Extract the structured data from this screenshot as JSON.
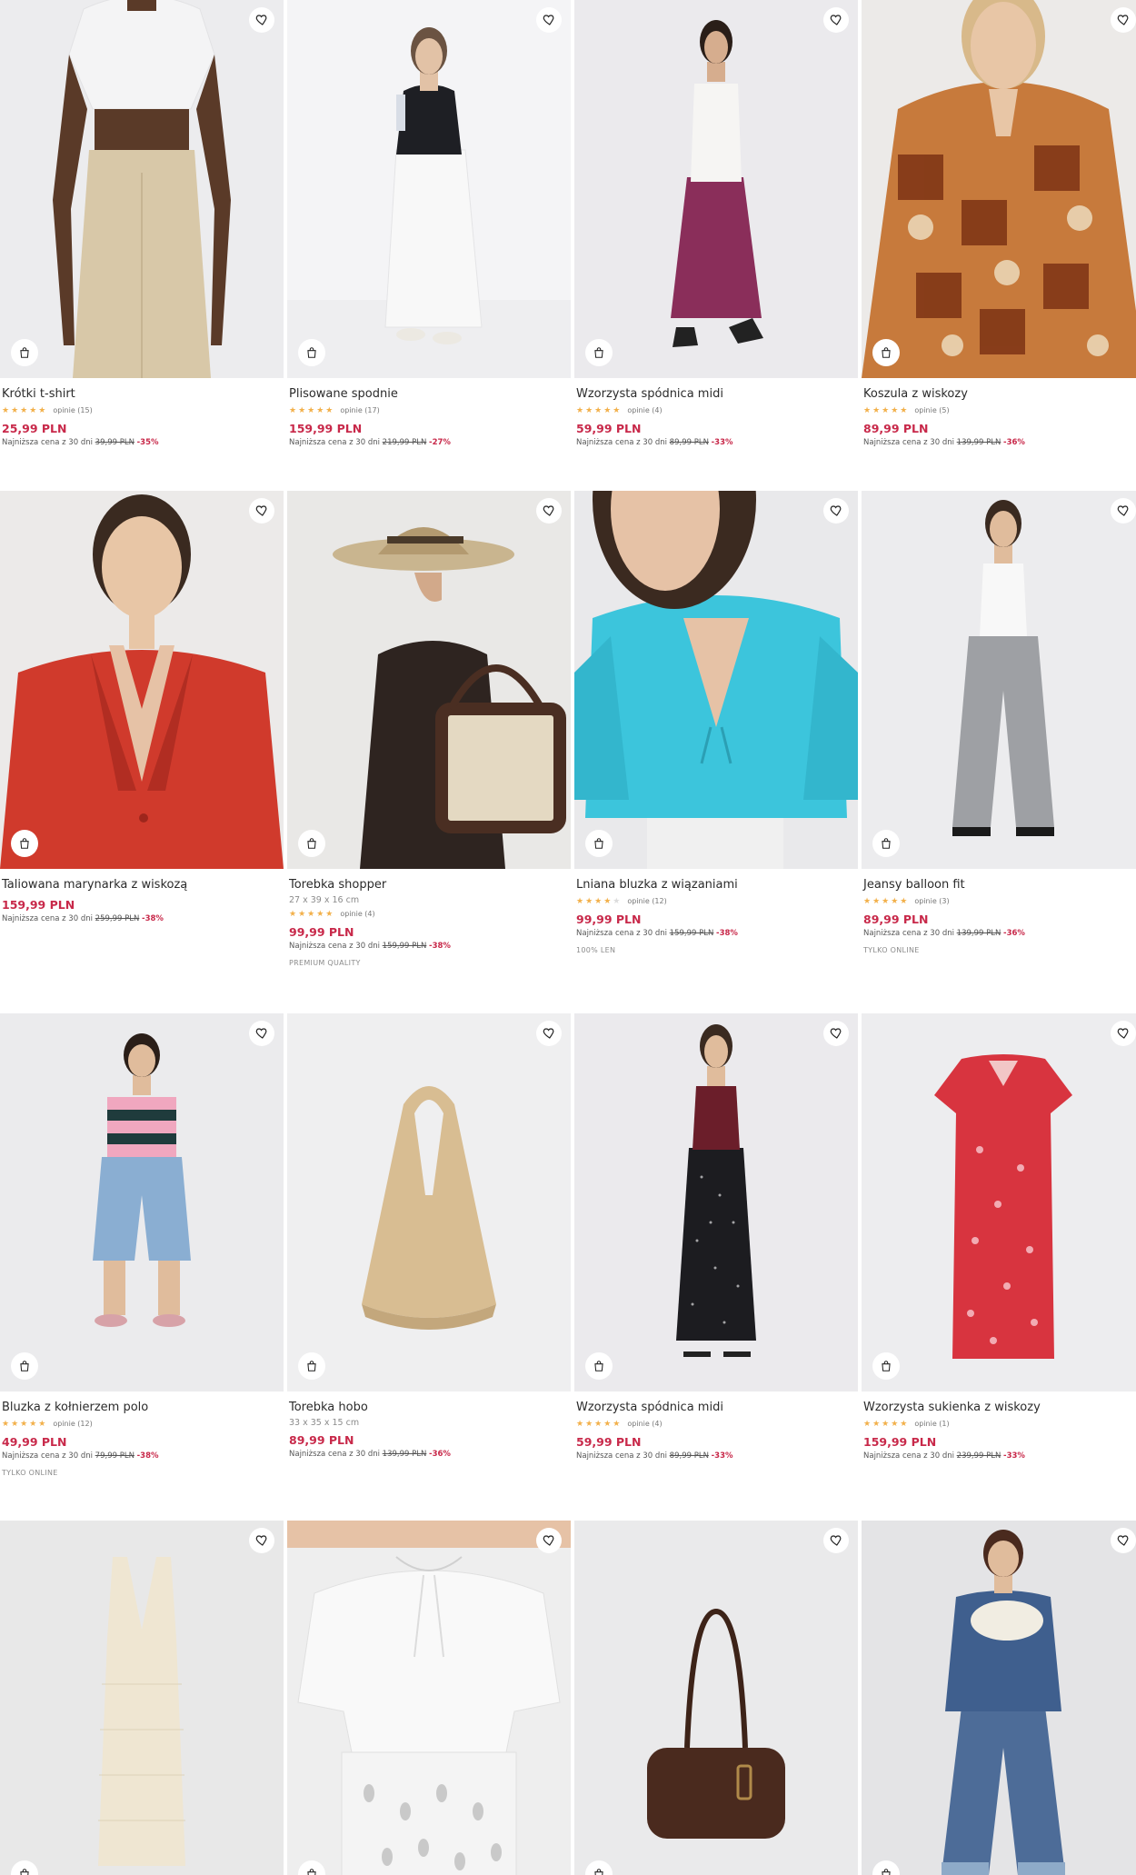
{
  "products": [
    {
      "name": "Krótki t-shirt",
      "dims": "",
      "stars": 4.5,
      "reviews": "opinie (15)",
      "price": "25,99 PLN",
      "lowest_label": "Najniższa cena z 30 dni",
      "old_price": "39,99 PLN",
      "discount": "-35%",
      "tag": "",
      "bg": "#ececee",
      "photo": "model-white-crop-top-beige-trousers"
    },
    {
      "name": "Plisowane spodnie",
      "dims": "",
      "stars": 4.5,
      "reviews": "opinie (17)",
      "price": "159,99 PLN",
      "lowest_label": "Najniższa cena z 30 dni",
      "old_price": "219,99 PLN",
      "discount": "-27%",
      "tag": "",
      "bg": "#eeeef0",
      "photo": "model-black-polo-white-pleated-trousers"
    },
    {
      "name": "Wzorzysta spódnica midi",
      "dims": "",
      "stars": 5,
      "reviews": "opinie (4)",
      "price": "59,99 PLN",
      "lowest_label": "Najniższa cena z 30 dni",
      "old_price": "89,99 PLN",
      "discount": "-33%",
      "tag": "",
      "bg": "#ebeaed",
      "photo": "model-white-top-burgundy-midi-skirt"
    },
    {
      "name": "Koszula z wiskozy",
      "dims": "",
      "stars": 4.5,
      "reviews": "opinie (5)",
      "price": "89,99 PLN",
      "lowest_label": "Najniższa cena z 30 dni",
      "old_price": "139,99 PLN",
      "discount": "-36%",
      "tag": "",
      "bg": "#eceae8",
      "photo": "model-patterned-viscose-shirt"
    },
    {
      "name": "Taliowana marynarka z wiskozą",
      "dims": "",
      "stars": 0,
      "reviews": "",
      "price": "159,99 PLN",
      "lowest_label": "Najniższa cena z 30 dni",
      "old_price": "259,99 PLN",
      "discount": "-38%",
      "tag": "",
      "bg": "#eceae9",
      "photo": "model-red-tailored-blazer"
    },
    {
      "name": "Torebka shopper",
      "dims": "27 x 39 x 16 cm",
      "stars": 5,
      "reviews": "opinie (4)",
      "price": "99,99 PLN",
      "lowest_label": "Najniższa cena z 30 dni",
      "old_price": "159,99 PLN",
      "discount": "-38%",
      "tag": "PREMIUM QUALITY",
      "bg": "#e9e8e6",
      "photo": "model-straw-hat-canvas-shopper-bag"
    },
    {
      "name": "Lniana bluzka z wiązaniami",
      "dims": "",
      "stars": 4,
      "reviews": "opinie (12)",
      "price": "99,99 PLN",
      "lowest_label": "Najniższa cena z 30 dni",
      "old_price": "159,99 PLN",
      "discount": "-38%",
      "tag": "100% LEN",
      "bg": "#e9e9eb",
      "photo": "model-turquoise-linen-blouse"
    },
    {
      "name": "Jeansy balloon fit",
      "dims": "",
      "stars": 4.5,
      "reviews": "opinie (3)",
      "price": "89,99 PLN",
      "lowest_label": "Najniższa cena z 30 dni",
      "old_price": "139,99 PLN",
      "discount": "-36%",
      "tag": "TYLKO ONLINE",
      "bg": "#ececee",
      "photo": "model-white-tank-grey-balloon-jeans"
    },
    {
      "name": "Bluzka z kołnierzem polo",
      "dims": "",
      "stars": 4.5,
      "reviews": "opinie (12)",
      "price": "49,99 PLN",
      "lowest_label": "Najniższa cena z 30 dni",
      "old_price": "79,99 PLN",
      "discount": "-38%",
      "tag": "TYLKO ONLINE",
      "bg": "#ebebed",
      "photo": "model-striped-polo-denim-shorts"
    },
    {
      "name": "Torebka hobo",
      "dims": "33 x 35 x 15 cm",
      "stars": 0,
      "reviews": "",
      "price": "89,99 PLN",
      "lowest_label": "Najniższa cena z 30 dni",
      "old_price": "139,99 PLN",
      "discount": "-36%",
      "tag": "",
      "bg": "#efeff0",
      "photo": "beige-hobo-bag"
    },
    {
      "name": "Wzorzysta spódnica midi",
      "dims": "",
      "stars": 5,
      "reviews": "opinie (4)",
      "price": "59,99 PLN",
      "lowest_label": "Najniższa cena z 30 dni",
      "old_price": "89,99 PLN",
      "discount": "-33%",
      "tag": "",
      "bg": "#ebeaed",
      "photo": "model-burgundy-tank-dotted-skirt"
    },
    {
      "name": "Wzorzysta sukienka z wiskozy",
      "dims": "",
      "stars": 5,
      "reviews": "opinie (1)",
      "price": "159,99 PLN",
      "lowest_label": "Najniższa cena z 30 dni",
      "old_price": "239,99 PLN",
      "discount": "-33%",
      "tag": "",
      "bg": "#ededef",
      "photo": "red-floral-viscose-dress"
    },
    {
      "name": "",
      "dims": "",
      "stars": 0,
      "reviews": "",
      "price": "",
      "lowest_label": "",
      "old_price": "",
      "discount": "",
      "tag": "",
      "bg": "#e8e8e8",
      "photo": "cream-crochet-dress"
    },
    {
      "name": "",
      "dims": "",
      "stars": 0,
      "reviews": "",
      "price": "",
      "lowest_label": "",
      "old_price": "",
      "discount": "",
      "tag": "",
      "bg": "#eeeeee",
      "photo": "white-blouse-broderie-skirt"
    },
    {
      "name": "",
      "dims": "",
      "stars": 0,
      "reviews": "",
      "price": "",
      "lowest_label": "",
      "old_price": "",
      "discount": "",
      "tag": "",
      "bg": "#eaeaeb",
      "photo": "brown-leather-shoulder-bag"
    },
    {
      "name": "",
      "dims": "",
      "stars": 0,
      "reviews": "",
      "price": "",
      "lowest_label": "",
      "old_price": "",
      "discount": "",
      "tag": "",
      "bg": "#e4e4e6",
      "photo": "model-denim-jacket-wide-jeans"
    }
  ],
  "icons": {
    "favorite": "heart-outline-icon",
    "add_to_cart": "shopping-bag-icon"
  },
  "colors": {
    "price": "#c8294a",
    "star": "#f2b04a",
    "text": "#2b2b2b",
    "muted": "#8b8b8b"
  }
}
